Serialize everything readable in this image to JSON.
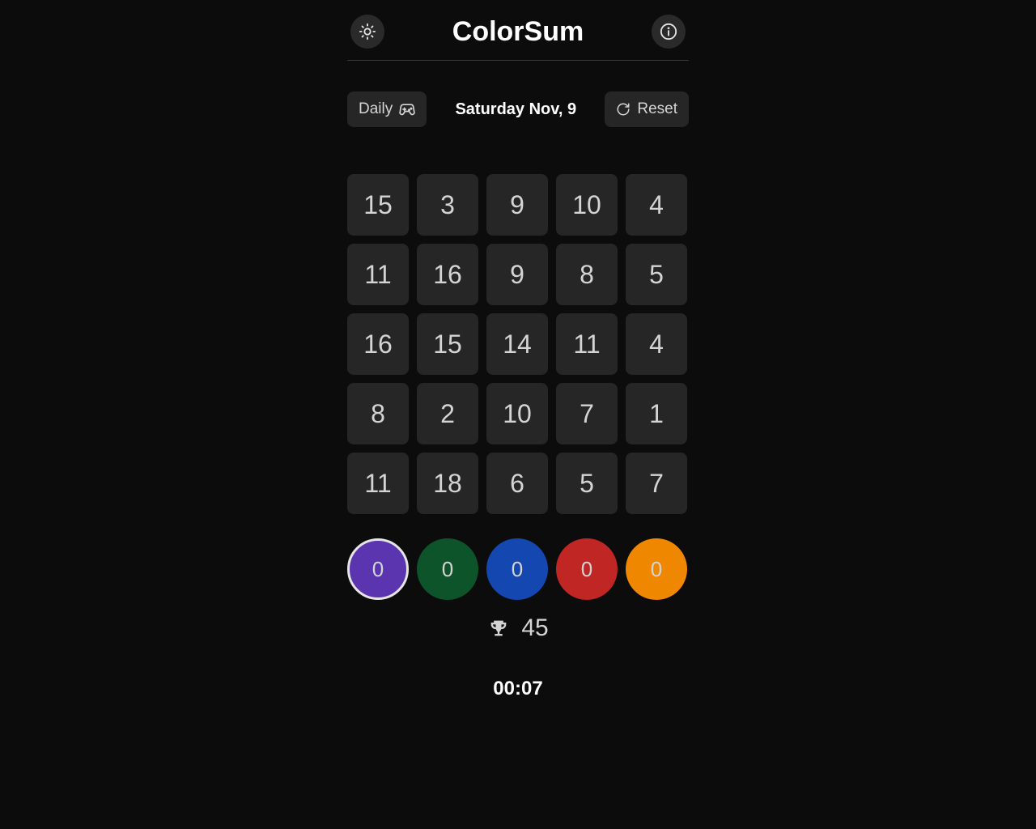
{
  "header": {
    "title": "ColorSum"
  },
  "subbar": {
    "daily_label": "Daily",
    "date_label": "Saturday Nov, 9",
    "reset_label": "Reset"
  },
  "grid": [
    [
      15,
      3,
      9,
      10,
      4
    ],
    [
      11,
      16,
      9,
      8,
      5
    ],
    [
      16,
      15,
      14,
      11,
      4
    ],
    [
      8,
      2,
      10,
      7,
      1
    ],
    [
      11,
      18,
      6,
      5,
      7
    ]
  ],
  "colors": [
    {
      "value": 0,
      "hex": "#5b34b0",
      "selected": true
    },
    {
      "value": 0,
      "hex": "#0d542b",
      "selected": false
    },
    {
      "value": 0,
      "hex": "#1447b0",
      "selected": false
    },
    {
      "value": 0,
      "hex": "#c02624",
      "selected": false
    },
    {
      "value": 0,
      "hex": "#f08700",
      "selected": false
    }
  ],
  "target": 45,
  "timer": "00:07",
  "colors_accent": {
    "cell_bg": "#262626",
    "page_bg": "#0c0c0c"
  }
}
